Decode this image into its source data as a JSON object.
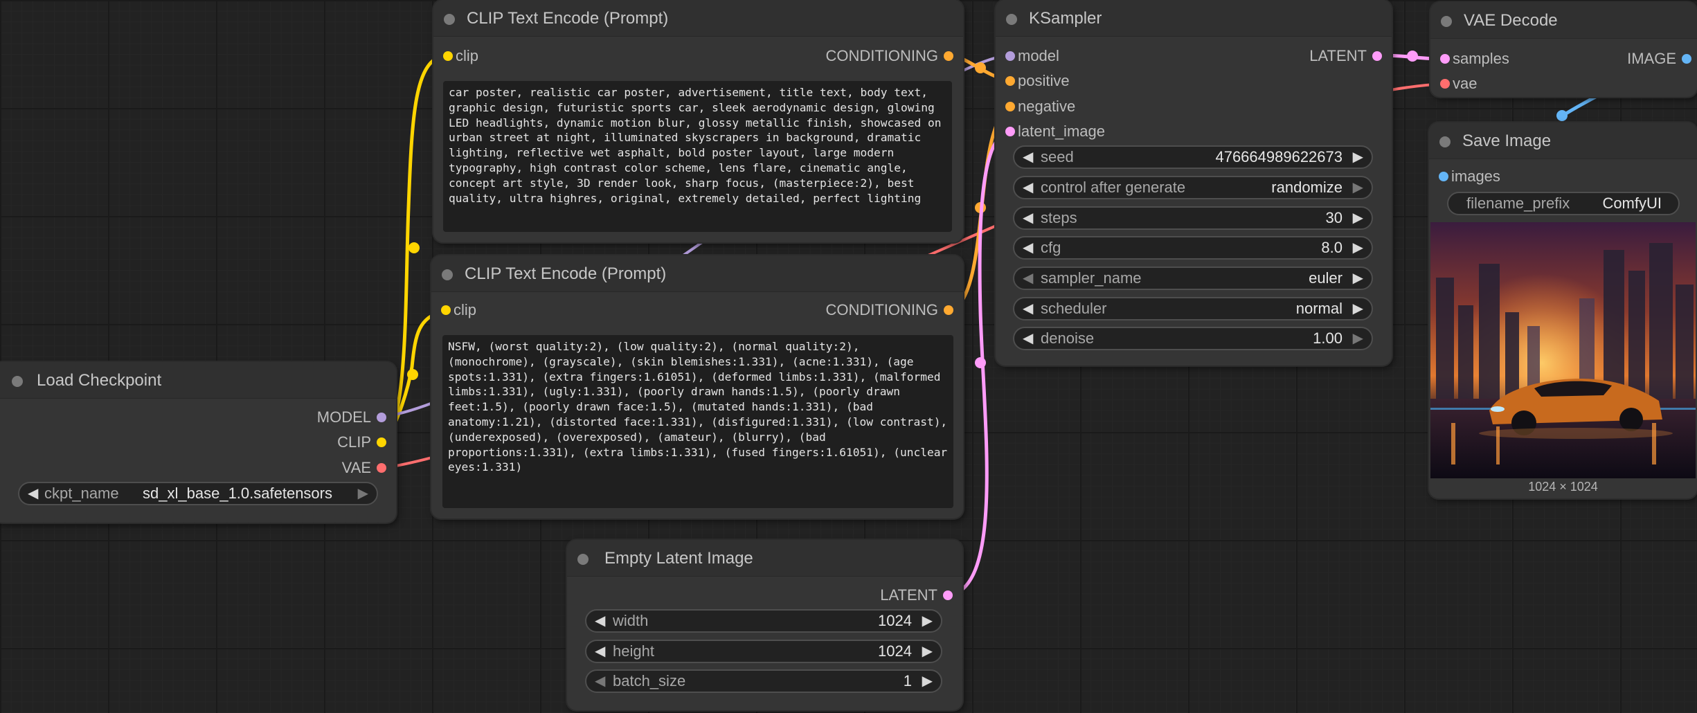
{
  "colors": {
    "model": "#b39ddb",
    "clip": "#ffd500",
    "vae": "#ff6e6e",
    "conditioning": "#ffa931",
    "latent": "#ff9cf9",
    "image": "#64b5f6"
  },
  "nodes": {
    "clip_pos": {
      "title": "CLIP Text Encode (Prompt)",
      "input_clip": "clip",
      "output": "CONDITIONING",
      "text": "car poster, realistic car poster, advertisement, title text, body text, graphic design, futuristic sports car, sleek aerodynamic design, glowing LED headlights, dynamic motion blur, glossy metallic finish, showcased on urban street at night, illuminated skyscrapers in background, dramatic lighting, reflective wet asphalt, bold poster layout, large modern typography, high contrast color scheme, lens flare, cinematic angle, concept art style, 3D render look, sharp focus, (masterpiece:2), best quality, ultra highres, original, extremely detailed, perfect lighting"
    },
    "clip_neg": {
      "title": "CLIP Text Encode (Prompt)",
      "input_clip": "clip",
      "output": "CONDITIONING",
      "text": "NSFW, (worst quality:2), (low quality:2), (normal quality:2), (monochrome), (grayscale), (skin blemishes:1.331), (acne:1.331), (age spots:1.331), (extra fingers:1.61051), (deformed limbs:1.331), (malformed limbs:1.331), (ugly:1.331), (poorly drawn hands:1.5), (poorly drawn feet:1.5), (poorly drawn face:1.5), (mutated hands:1.331), (bad anatomy:1.21), (distorted face:1.331), (disfigured:1.331), (low contrast), (underexposed), (overexposed), (amateur), (blurry), (bad proportions:1.331), (extra limbs:1.331), (fused fingers:1.61051), (unclear eyes:1.331)"
    },
    "ksampler": {
      "title": "KSampler",
      "inputs": [
        "model",
        "positive",
        "negative",
        "latent_image"
      ],
      "output": "LATENT",
      "widgets": [
        {
          "name": "seed",
          "value": "476664989622673"
        },
        {
          "name": "control after generate",
          "value": "randomize"
        },
        {
          "name": "steps",
          "value": "30"
        },
        {
          "name": "cfg",
          "value": "8.0"
        },
        {
          "name": "sampler_name",
          "value": "euler"
        },
        {
          "name": "scheduler",
          "value": "normal"
        },
        {
          "name": "denoise",
          "value": "1.00"
        }
      ]
    },
    "vae_decode": {
      "title": "VAE Decode",
      "inputs": [
        "samples",
        "vae"
      ],
      "output": "IMAGE"
    },
    "save_image": {
      "title": "Save Image",
      "input": "images",
      "widget": {
        "name": "filename_prefix",
        "value": "ComfyUI"
      },
      "caption": "1024 × 1024"
    },
    "load_checkpoint": {
      "title": "Load Checkpoint",
      "outputs": [
        "MODEL",
        "CLIP",
        "VAE"
      ],
      "widget": {
        "name": "ckpt_name",
        "value": "sd_xl_base_1.0.safetensors"
      }
    },
    "empty_latent": {
      "title": "Empty Latent Image",
      "output": "LATENT",
      "widgets": [
        {
          "name": "width",
          "value": "1024"
        },
        {
          "name": "height",
          "value": "1024"
        },
        {
          "name": "batch_size",
          "value": "1"
        }
      ]
    }
  }
}
